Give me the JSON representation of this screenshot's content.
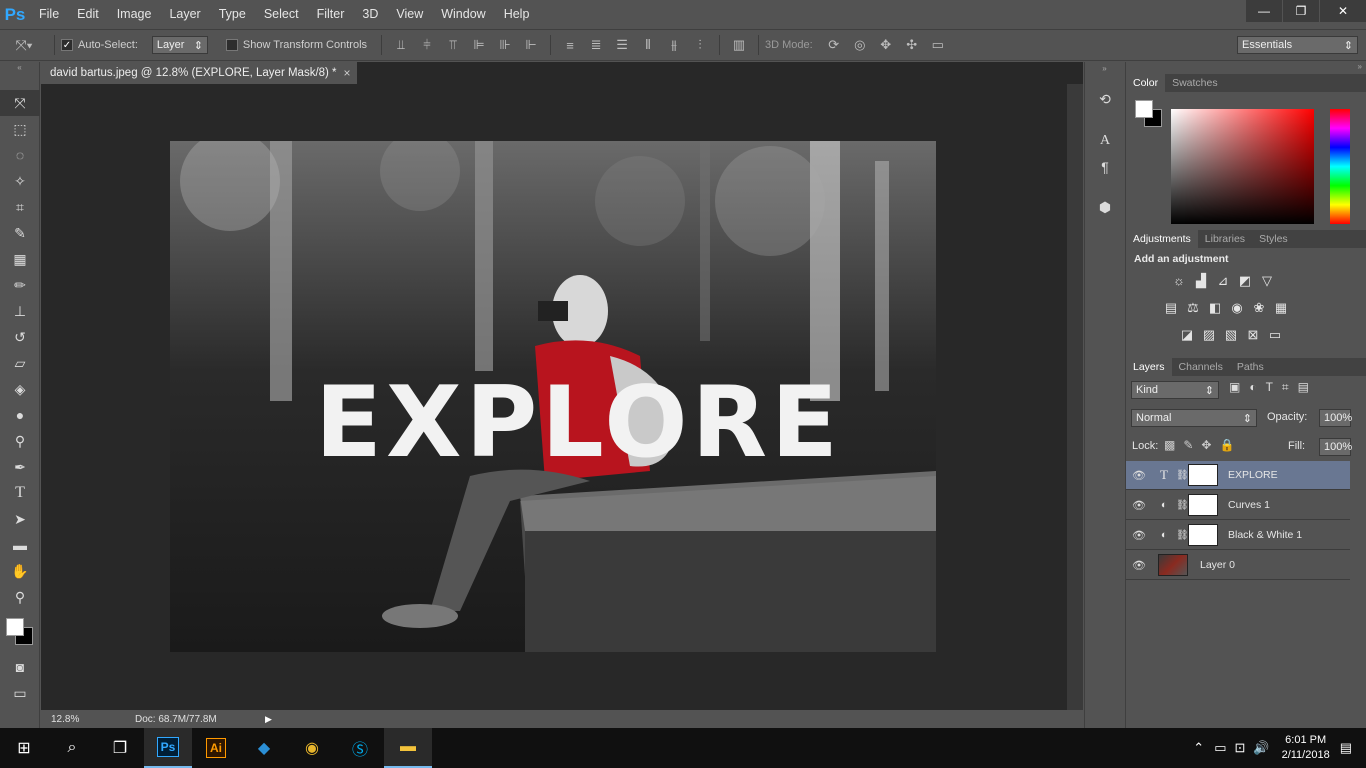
{
  "app": {
    "logo": "Ps"
  },
  "menu": [
    "File",
    "Edit",
    "Image",
    "Layer",
    "Type",
    "Select",
    "Filter",
    "3D",
    "View",
    "Window",
    "Help"
  ],
  "window_controls": {
    "minimize": "—",
    "restore": "❐",
    "close": "✕"
  },
  "options": {
    "auto_select_label": "Auto-Select:",
    "auto_select_checked": "✓",
    "auto_select_value": "Layer",
    "show_transform_label": "Show Transform Controls",
    "mode_3d_label": "3D Mode:",
    "workspace": "Essentials"
  },
  "document": {
    "tab_title": "david bartus.jpeg @ 12.8% (EXPLORE, Layer Mask/8) *",
    "close": "×",
    "overlay_text": "EXPLORE",
    "zoom": "12.8%",
    "doc_info": "Doc: 68.7M/77.8M"
  },
  "panels": {
    "color_tabs": [
      "Color",
      "Swatches"
    ],
    "adjust_tabs": [
      "Adjustments",
      "Libraries",
      "Styles"
    ],
    "adjust_heading": "Add an adjustment",
    "layers_tabs": [
      "Layers",
      "Channels",
      "Paths"
    ],
    "kind_label": "Kind",
    "blend_mode": "Normal",
    "opacity_label": "Opacity:",
    "opacity_value": "100%",
    "lock_label": "Lock:",
    "fill_label": "Fill:",
    "fill_value": "100%",
    "layers": [
      {
        "name": "EXPLORE",
        "type_icon": "T",
        "selected": true
      },
      {
        "name": "Curves 1",
        "type_icon": "◐",
        "selected": false
      },
      {
        "name": "Black & White 1",
        "type_icon": "◐",
        "selected": false
      },
      {
        "name": "Layer 0",
        "type_icon": "",
        "selected": false
      }
    ]
  },
  "taskbar": {
    "time": "6:01 PM",
    "date": "2/11/2018"
  },
  "colors": {
    "photoshop_blue": "#31a8ff",
    "selected_layer": "#697792",
    "jacket_red": "#b8141e"
  }
}
